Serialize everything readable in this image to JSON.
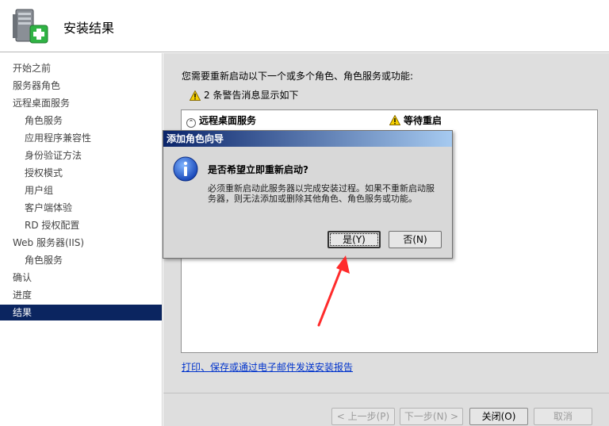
{
  "header": {
    "title": "安装结果"
  },
  "nav": {
    "items": [
      {
        "label": "开始之前",
        "sub": false,
        "active": false
      },
      {
        "label": "服务器角色",
        "sub": false,
        "active": false
      },
      {
        "label": "远程桌面服务",
        "sub": false,
        "active": false
      },
      {
        "label": "角色服务",
        "sub": true,
        "active": false
      },
      {
        "label": "应用程序兼容性",
        "sub": true,
        "active": false
      },
      {
        "label": "身份验证方法",
        "sub": true,
        "active": false
      },
      {
        "label": "授权模式",
        "sub": true,
        "active": false
      },
      {
        "label": "用户组",
        "sub": true,
        "active": false
      },
      {
        "label": "客户端体验",
        "sub": true,
        "active": false
      },
      {
        "label": "RD 授权配置",
        "sub": true,
        "active": false
      },
      {
        "label": "Web 服务器(IIS)",
        "sub": false,
        "active": false
      },
      {
        "label": "角色服务",
        "sub": true,
        "active": false
      },
      {
        "label": "确认",
        "sub": false,
        "active": false
      },
      {
        "label": "进度",
        "sub": false,
        "active": false
      },
      {
        "label": "结果",
        "sub": false,
        "active": true
      }
    ]
  },
  "main": {
    "intro": "您需要重新启动以下一个或多个角色、角色服务或功能:",
    "warning_summary": "2 条警告消息显示如下",
    "results": {
      "role": "远程桌面服务",
      "status": "等待重启"
    },
    "report_link": "打印、保存或通过电子邮件发送安装报告"
  },
  "footer": {
    "prev_label": "< 上一步(P)",
    "next_label": "下一步(N) >",
    "close_label": "关闭(O)",
    "cancel_label": "取消"
  },
  "dialog": {
    "title": "添加角色向导",
    "question": "是否希望立即重新启动?",
    "description": "必须重新启动此服务器以完成安装过程。如果不重新启动服务器，则无法添加或删除其他角色、角色服务或功能。",
    "yes_label": "是(Y)",
    "no_label": "否(N)"
  },
  "colors": {
    "nav_active_bg": "#0b2560",
    "dialog_title_start": "#0a246a",
    "dialog_title_end": "#a6caf0",
    "link": "#0033cc",
    "annotation_arrow": "#ff2b2b"
  },
  "icons": {
    "header": "server-roles-add-icon",
    "dialog": "info-icon",
    "warning": "warning-icon"
  }
}
